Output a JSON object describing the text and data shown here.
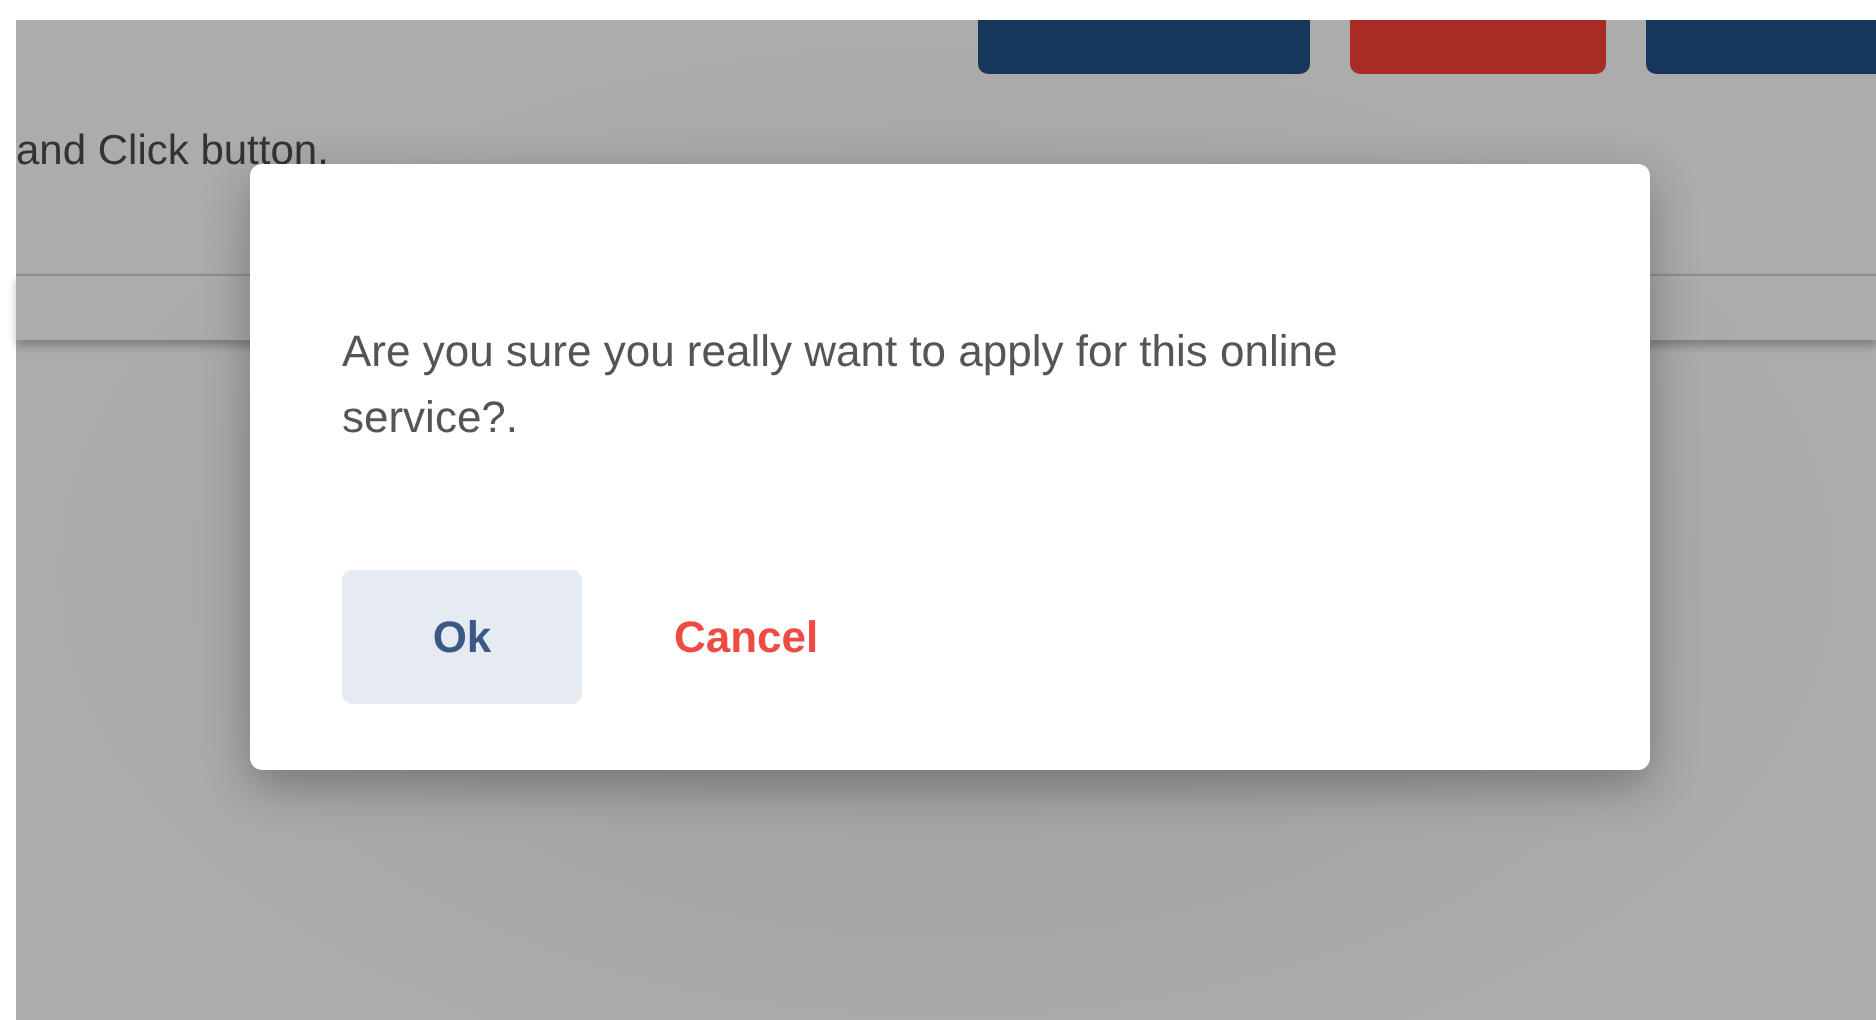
{
  "header_buttons": [
    {
      "color": "#17365b"
    },
    {
      "color": "#a62c24"
    },
    {
      "color": "#17365b"
    }
  ],
  "instruction": "and Click button.",
  "dialog": {
    "message": "Are you sure you really want to apply for this online service?.",
    "buttons": [
      {
        "label": "Ok",
        "kind": "primary"
      },
      {
        "label": "Cancel",
        "kind": "danger"
      }
    ]
  }
}
